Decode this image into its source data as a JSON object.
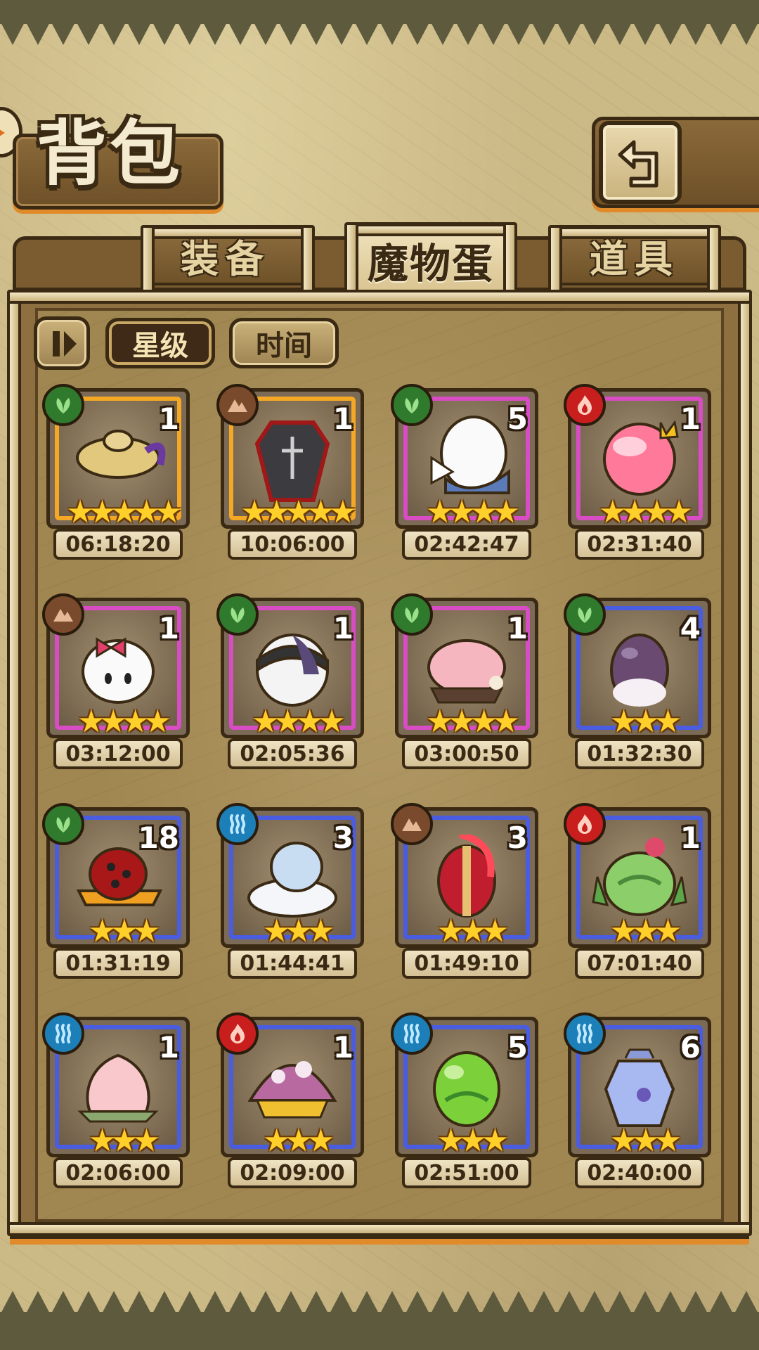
{
  "header": {
    "title": "背包",
    "back_icon": "back-arrow-icon"
  },
  "tabs": [
    {
      "label": "装备",
      "active": false
    },
    {
      "label": "魔物蛋",
      "active": true
    },
    {
      "label": "道具",
      "active": false
    }
  ],
  "sort": {
    "toggle_icon": "sort-order-icon",
    "buttons": [
      {
        "label": "星级",
        "active": true
      },
      {
        "label": "时间",
        "active": false
      }
    ]
  },
  "colors": {
    "rarity_gold": "#f4a824",
    "rarity_pink": "#d84cc4",
    "rarity_blue": "#4a5ce0",
    "element_nature": "#2f7a2c",
    "element_earth": "#7a4a2c",
    "element_fire": "#c81e1e",
    "element_water": "#1c7fb8"
  },
  "eggs": [
    {
      "element": "nature",
      "count": "1",
      "stars": 5,
      "rarity": "gold",
      "time": "06:18:20",
      "art": "magic-lamp-egg"
    },
    {
      "element": "earth",
      "count": "1",
      "stars": 5,
      "rarity": "gold",
      "time": "10:06:00",
      "art": "coffin-egg"
    },
    {
      "element": "nature",
      "count": "5",
      "stars": 4,
      "rarity": "pink",
      "time": "02:42:47",
      "art": "winged-egg"
    },
    {
      "element": "fire",
      "count": "1",
      "stars": 4,
      "rarity": "pink",
      "time": "02:31:40",
      "art": "crowned-pink-egg"
    },
    {
      "element": "earth",
      "count": "1",
      "stars": 4,
      "rarity": "pink",
      "time": "03:12:00",
      "art": "bow-cracked-egg"
    },
    {
      "element": "nature",
      "count": "1",
      "stars": 4,
      "rarity": "pink",
      "time": "02:05:36",
      "art": "spiked-helmet-egg"
    },
    {
      "element": "nature",
      "count": "1",
      "stars": 4,
      "rarity": "pink",
      "time": "03:00:50",
      "art": "pink-furry-egg"
    },
    {
      "element": "nature",
      "count": "4",
      "stars": 3,
      "rarity": "blue",
      "time": "01:32:30",
      "art": "purple-fluffy-egg"
    },
    {
      "element": "nature",
      "count": "18",
      "stars": 3,
      "rarity": "blue",
      "time": "01:31:19",
      "art": "ladybug-hat-egg"
    },
    {
      "element": "water",
      "count": "3",
      "stars": 3,
      "rarity": "blue",
      "time": "01:44:41",
      "art": "cloud-egg"
    },
    {
      "element": "earth",
      "count": "3",
      "stars": 3,
      "rarity": "blue",
      "time": "01:49:10",
      "art": "spartan-helmet-egg"
    },
    {
      "element": "fire",
      "count": "1",
      "stars": 3,
      "rarity": "blue",
      "time": "07:01:40",
      "art": "cactus-egg"
    },
    {
      "element": "water",
      "count": "1",
      "stars": 3,
      "rarity": "blue",
      "time": "02:06:00",
      "art": "peach-egg"
    },
    {
      "element": "fire",
      "count": "1",
      "stars": 3,
      "rarity": "blue",
      "time": "02:09:00",
      "art": "mushroom-egg"
    },
    {
      "element": "water",
      "count": "5",
      "stars": 3,
      "rarity": "blue",
      "time": "02:51:00",
      "art": "green-slime-egg"
    },
    {
      "element": "water",
      "count": "6",
      "stars": 3,
      "rarity": "blue",
      "time": "02:40:00",
      "art": "crystal-egg"
    }
  ]
}
